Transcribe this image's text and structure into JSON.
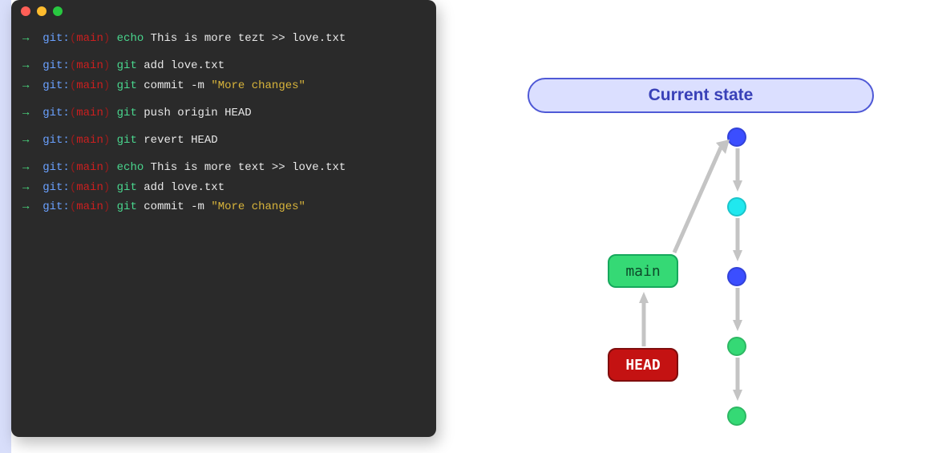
{
  "terminal": {
    "lines": [
      {
        "arrow": "→",
        "git": "git:",
        "lparen": "(",
        "branch": "main",
        "rparen": ")",
        "cmd": "echo",
        "args": "This is more tezt >> love.txt",
        "spacer": true
      },
      {
        "arrow": "→",
        "git": "git:",
        "lparen": "(",
        "branch": "main",
        "rparen": ")",
        "cmd": "git",
        "args": "add love.txt"
      },
      {
        "arrow": "→",
        "git": "git:",
        "lparen": "(",
        "branch": "main",
        "rparen": ")",
        "cmd": "git",
        "args": "commit -m",
        "str": "\"More changes\"",
        "spacer": true
      },
      {
        "arrow": "→",
        "git": "git:",
        "lparen": "(",
        "branch": "main",
        "rparen": ")",
        "cmd": "git",
        "args": "push origin HEAD",
        "spacer": true
      },
      {
        "arrow": "→",
        "git": "git:",
        "lparen": "(",
        "branch": "main",
        "rparen": ")",
        "cmd": "git",
        "args": "revert HEAD",
        "spacer": true
      },
      {
        "arrow": "→",
        "git": "git:",
        "lparen": "(",
        "branch": "main",
        "rparen": ")",
        "cmd": "echo",
        "args": "This is more text >> love.txt"
      },
      {
        "arrow": "→",
        "git": "git:",
        "lparen": "(",
        "branch": "main",
        "rparen": ")",
        "cmd": "git",
        "args": "add love.txt"
      },
      {
        "arrow": "→",
        "git": "git:",
        "lparen": "(",
        "branch": "main",
        "rparen": ")",
        "cmd": "git",
        "args": "commit -m",
        "str": "\"More changes\""
      }
    ]
  },
  "diagram": {
    "title": "Current state",
    "main_label": "main",
    "head_label": "HEAD",
    "commits": [
      {
        "kind": "blue"
      },
      {
        "kind": "cyan"
      },
      {
        "kind": "blue"
      },
      {
        "kind": "green"
      },
      {
        "kind": "green"
      }
    ]
  },
  "colors": {
    "pillBg": "#dbdfff",
    "pillBorder": "#4f59d6",
    "pillText": "#3941b8",
    "commitBlue": "#3b4eff",
    "commitCyan": "#20e8ef",
    "commitGreen": "#35d975",
    "arrow": "#c4c4c4",
    "mainBg": "#35d975",
    "headBg": "#c41212"
  }
}
